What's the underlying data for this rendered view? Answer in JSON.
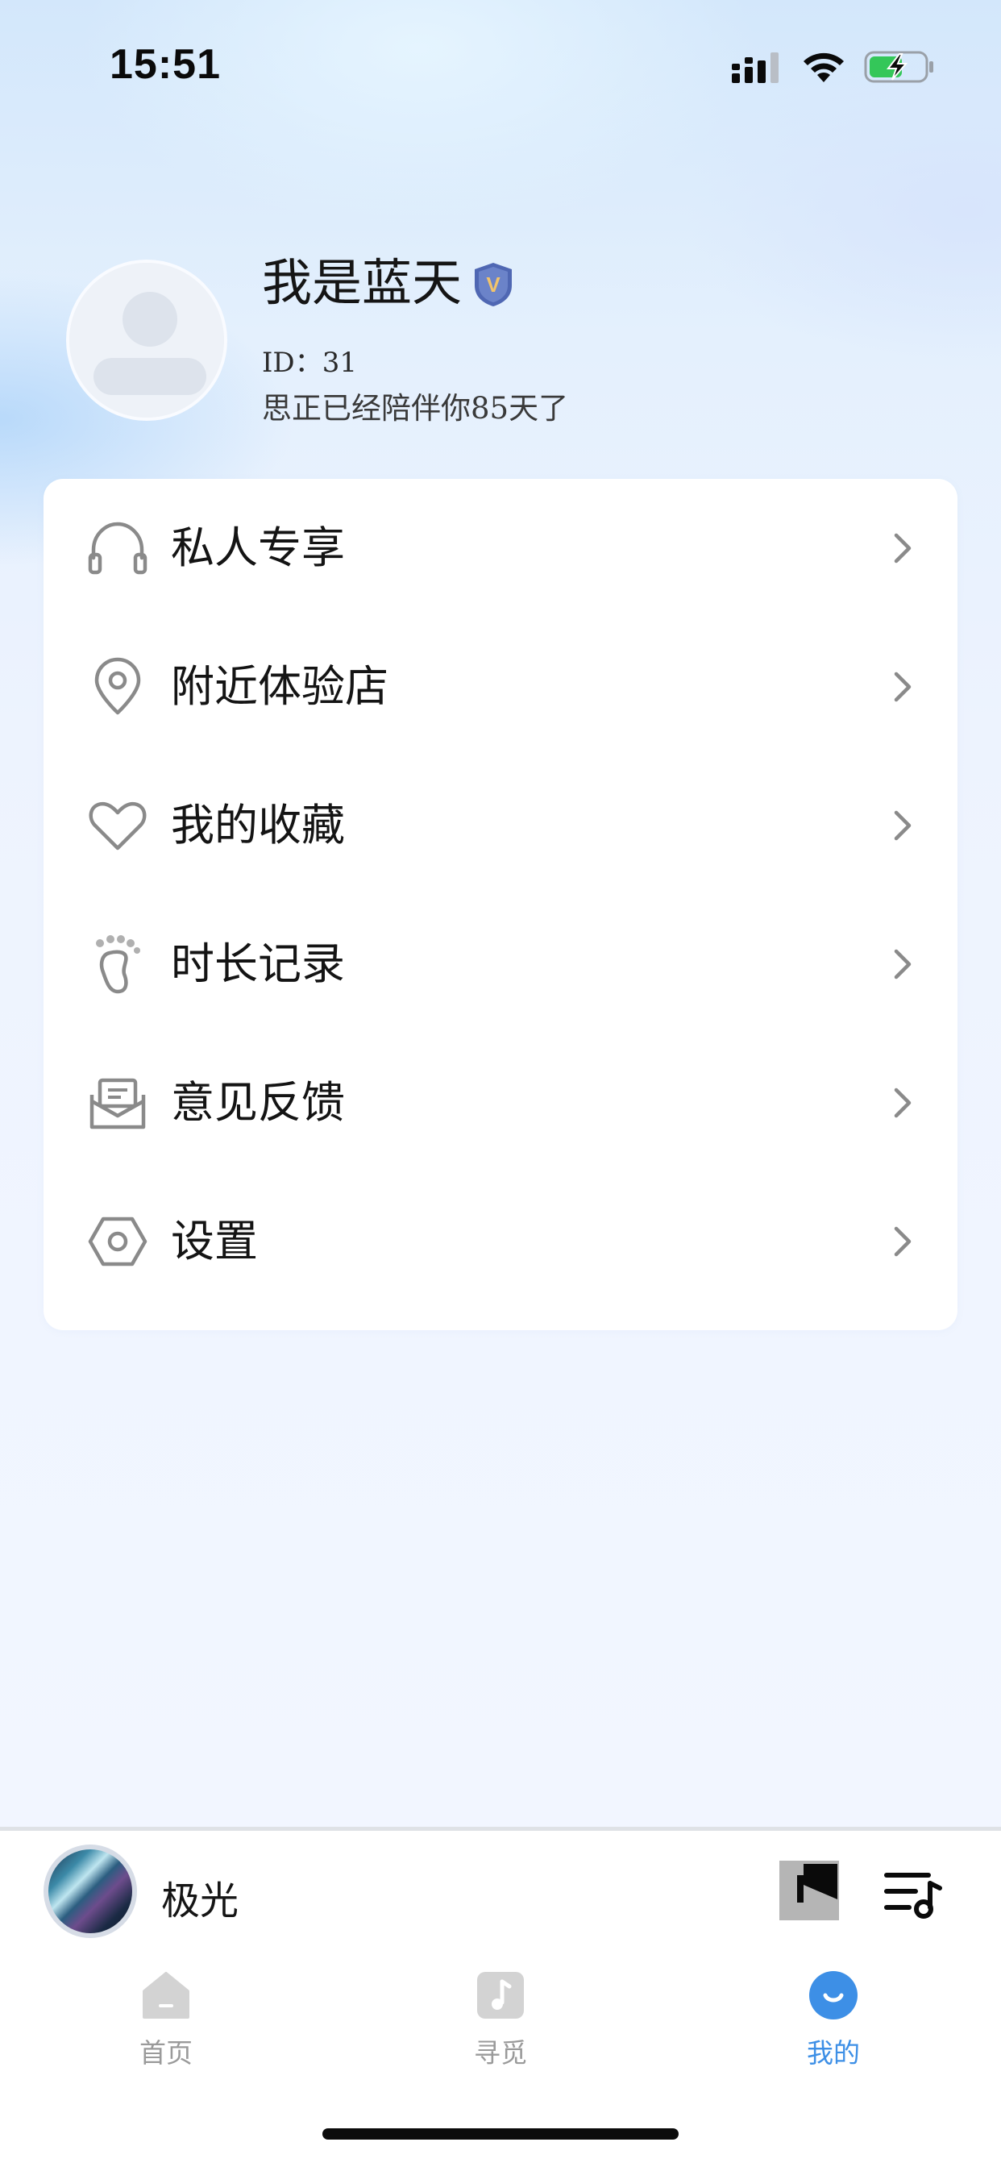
{
  "status_bar": {
    "time": "15:51",
    "signal_icon": "cellular-signal-icon",
    "wifi_icon": "wifi-icon",
    "battery_icon": "battery-charging-icon",
    "battery_color": "#34c759"
  },
  "profile": {
    "avatar_icon": "default-avatar-icon",
    "username": "我是蓝天",
    "badge_icon": "vip-shield-badge-icon",
    "badge_letter": "V",
    "id_text": "ID：31",
    "companion_text": "思正已经陪伴你85天了"
  },
  "menu": {
    "items": [
      {
        "label": "私人专享",
        "icon": "headphones-icon"
      },
      {
        "label": "附近体验店",
        "icon": "location-pin-icon"
      },
      {
        "label": "我的收藏",
        "icon": "heart-icon"
      },
      {
        "label": "时长记录",
        "icon": "footprint-icon"
      },
      {
        "label": "意见反馈",
        "icon": "feedback-mail-icon"
      },
      {
        "label": "设置",
        "icon": "settings-hexagon-icon"
      }
    ]
  },
  "player": {
    "title": "极光",
    "cover_icon": "aurora-cover-art",
    "play_icon": "play-pause-icon",
    "playlist_icon": "playlist-music-icon"
  },
  "tab_bar": {
    "tabs": [
      {
        "label": "首页",
        "icon": "home-icon",
        "active": false
      },
      {
        "label": "寻觅",
        "icon": "music-note-icon",
        "active": false
      },
      {
        "label": "我的",
        "icon": "smile-profile-icon",
        "active": true
      }
    ],
    "active_color": "#3d8fe6",
    "inactive_color": "#9a9a9a"
  }
}
